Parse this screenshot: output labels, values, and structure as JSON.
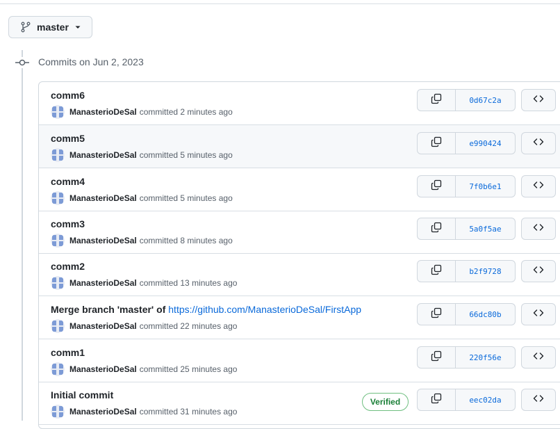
{
  "branch": {
    "name": "master",
    "icon": "git-branch-icon"
  },
  "group_title": "Commits on Jun 2, 2023",
  "colors": {
    "link": "#0969da",
    "verified": "#1a7f37",
    "border": "#d0d7de",
    "muted": "#57606a"
  },
  "commits": [
    {
      "title": "comm6",
      "title_link": "",
      "author": "ManasterioDeSal",
      "time": "committed 2 minutes ago",
      "sha": "0d67c2a",
      "verified": ""
    },
    {
      "title": "comm5",
      "title_link": "",
      "author": "ManasterioDeSal",
      "time": "committed 5 minutes ago",
      "sha": "e990424",
      "verified": ""
    },
    {
      "title": "comm4",
      "title_link": "",
      "author": "ManasterioDeSal",
      "time": "committed 5 minutes ago",
      "sha": "7f0b6e1",
      "verified": ""
    },
    {
      "title": "comm3",
      "title_link": "",
      "author": "ManasterioDeSal",
      "time": "committed 8 minutes ago",
      "sha": "5a0f5ae",
      "verified": ""
    },
    {
      "title": "comm2",
      "title_link": "",
      "author": "ManasterioDeSal",
      "time": "committed 13 minutes ago",
      "sha": "b2f9728",
      "verified": ""
    },
    {
      "title": "Merge branch 'master' of ",
      "title_link": "https://github.com/ManasterioDeSal/FirstApp",
      "author": "ManasterioDeSal",
      "time": "committed 22 minutes ago",
      "sha": "66dc80b",
      "verified": ""
    },
    {
      "title": "comm1",
      "title_link": "",
      "author": "ManasterioDeSal",
      "time": "committed 25 minutes ago",
      "sha": "220f56e",
      "verified": ""
    },
    {
      "title": "Initial commit",
      "title_link": "",
      "author": "ManasterioDeSal",
      "time": "committed 31 minutes ago",
      "sha": "eec02da",
      "verified": "Verified"
    }
  ]
}
